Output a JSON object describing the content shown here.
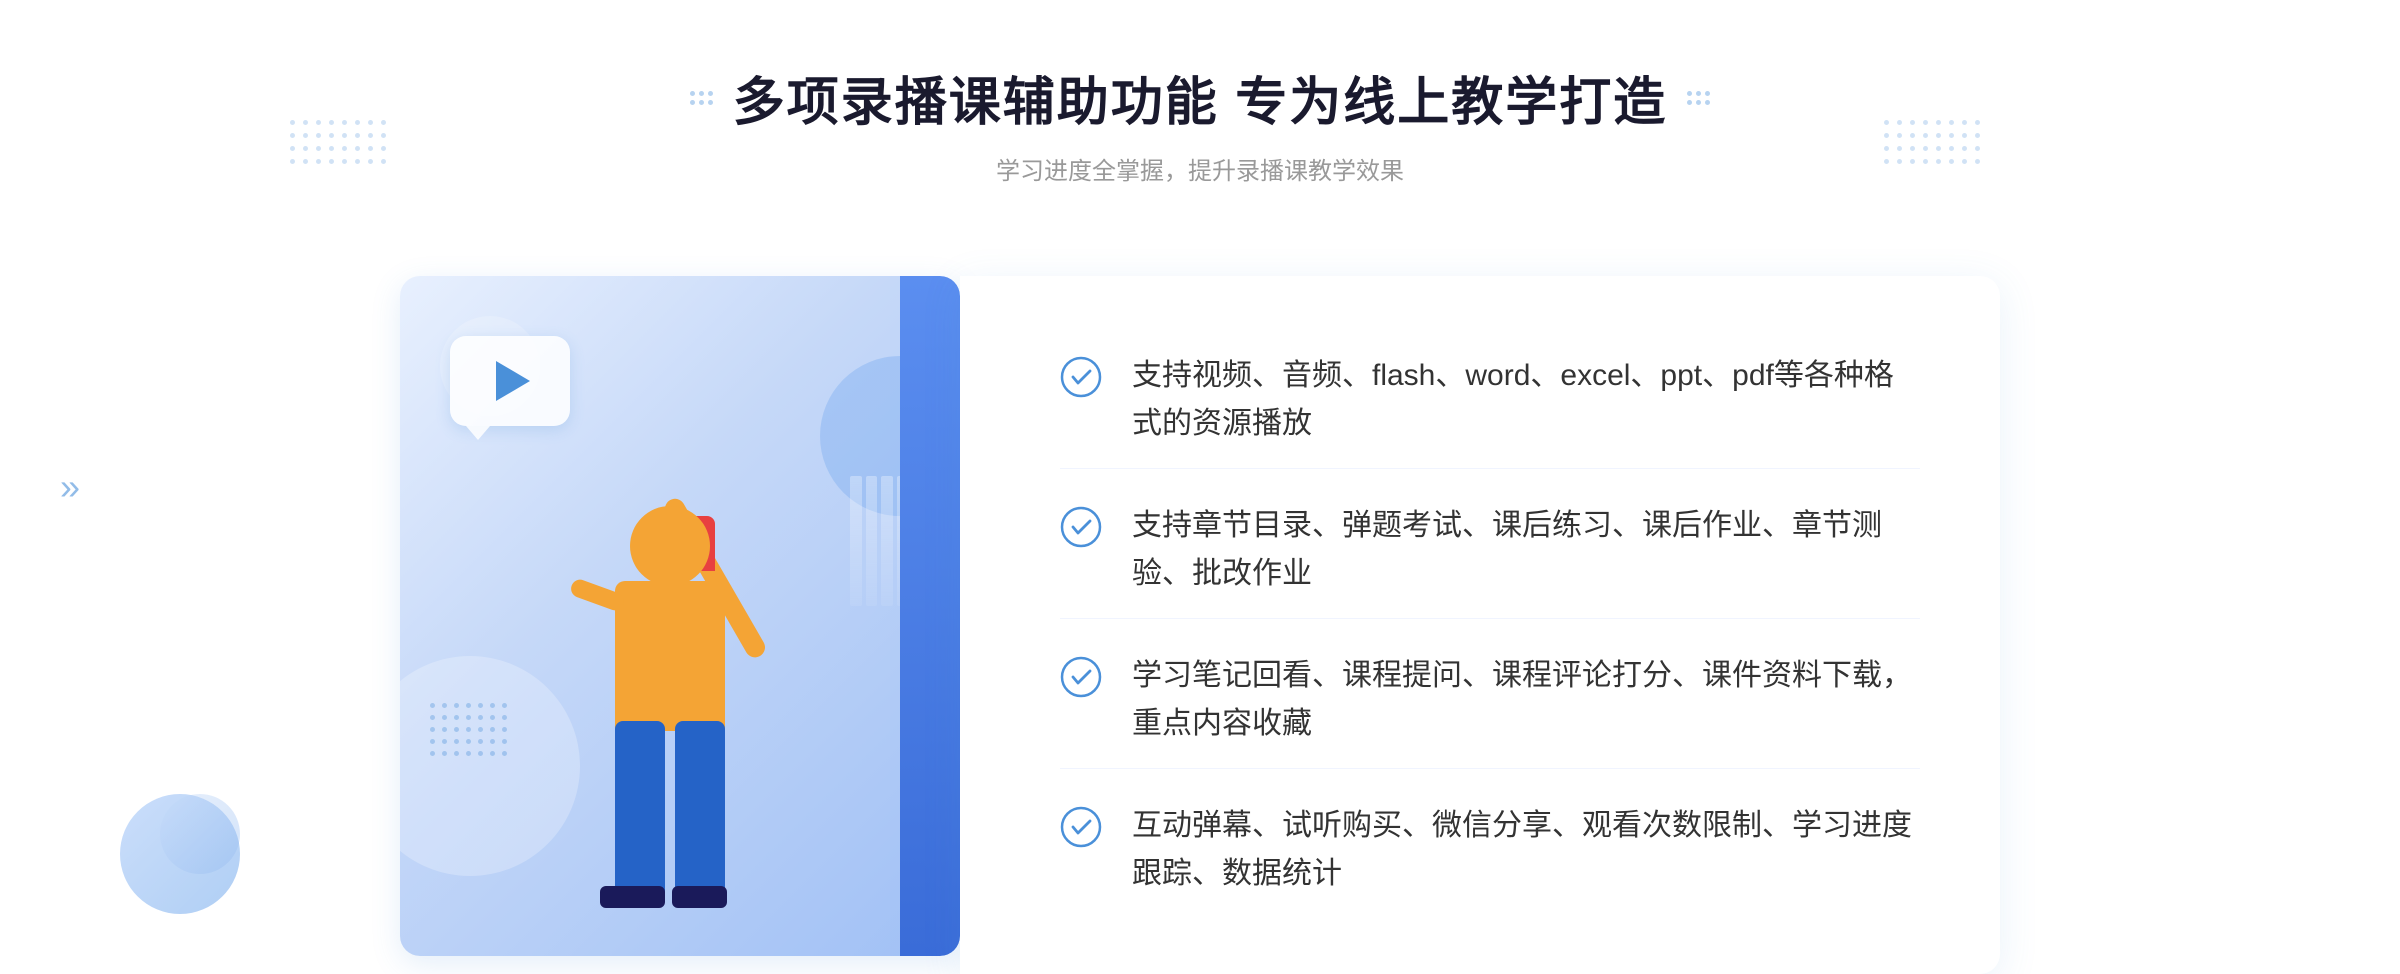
{
  "page": {
    "background_color": "#ffffff"
  },
  "header": {
    "title": "多项录播课辅助功能 专为线上教学打造",
    "subtitle": "学习进度全掌握，提升录播课教学效果"
  },
  "features": [
    {
      "id": 1,
      "text": "支持视频、音频、flash、word、excel、ppt、pdf等各种格式的资源播放"
    },
    {
      "id": 2,
      "text": "支持章节目录、弹题考试、课后练习、课后作业、章节测验、批改作业"
    },
    {
      "id": 3,
      "text": "学习笔记回看、课程提问、课程评论打分、课件资料下载，重点内容收藏"
    },
    {
      "id": 4,
      "text": "互动弹幕、试听购买、微信分享、观看次数限制、学习进度跟踪、数据统计"
    }
  ],
  "icons": {
    "check": "check-circle-icon",
    "arrow_left": "»",
    "arrow_right": "»"
  },
  "colors": {
    "primary": "#4a90d9",
    "title": "#1a1a2e",
    "text": "#333333",
    "subtitle": "#999999",
    "panel_bg": "#ffffff",
    "illus_bg_start": "#e8f0fe",
    "illus_bg_end": "#a0c0f5"
  }
}
